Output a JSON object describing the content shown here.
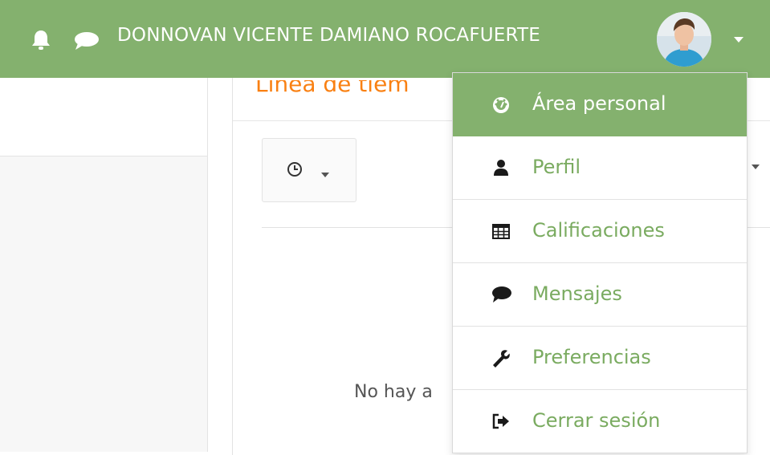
{
  "navbar": {
    "username": "DONNOVAN VICENTE DAMIANO ROCAFUERTE",
    "icons": [
      "bell-icon",
      "message-icon",
      "chevron-down-icon"
    ],
    "background": "#84b16e"
  },
  "main": {
    "card_title": "Línea de tiem",
    "empty_message": "No hay a"
  },
  "user_menu": {
    "items": [
      {
        "label": "Área personal",
        "icon": "dashboard-gauge-icon",
        "active": true
      },
      {
        "label": "Perfil",
        "icon": "user-icon",
        "active": false
      },
      {
        "label": "Calificaciones",
        "icon": "table-grid-icon",
        "active": false
      },
      {
        "label": "Mensajes",
        "icon": "speech-bubble-icon",
        "active": false
      },
      {
        "label": "Preferencias",
        "icon": "wrench-icon",
        "active": false
      },
      {
        "label": "Cerrar sesión",
        "icon": "sign-out-icon",
        "active": false
      }
    ]
  },
  "colors": {
    "accent_green": "#84b16e",
    "link_green": "#7aab60",
    "title_orange": "#f98012"
  }
}
